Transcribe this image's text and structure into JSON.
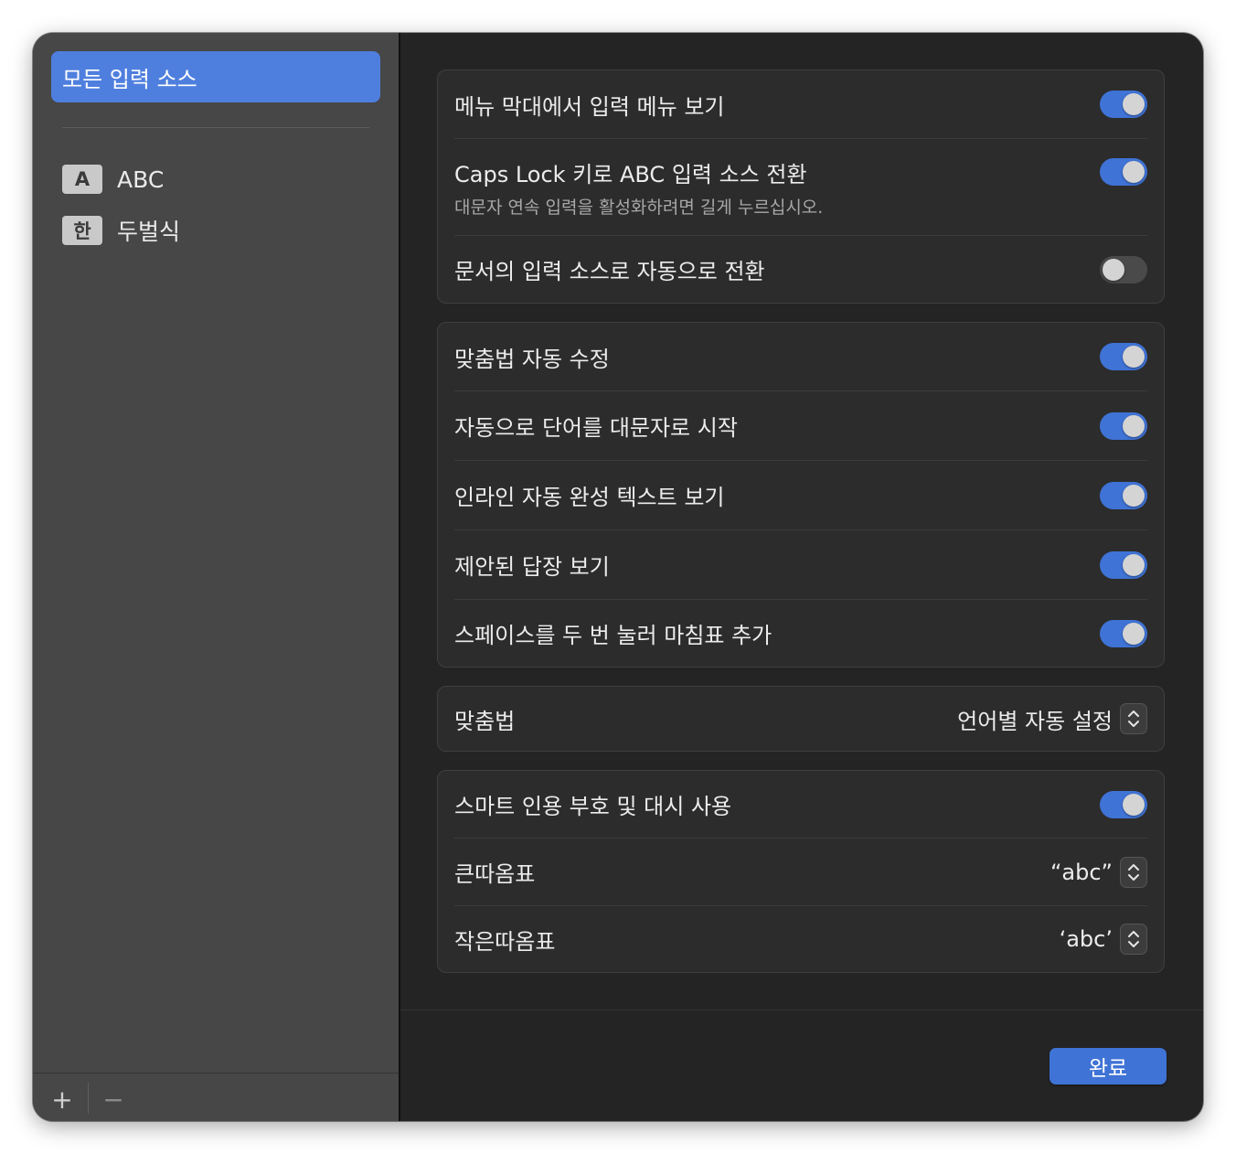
{
  "sidebar": {
    "selected_label": "모든 입력 소스",
    "sources": [
      {
        "badge": "A",
        "label": "ABC"
      },
      {
        "badge": "한",
        "label": "두벌식"
      }
    ],
    "add_label": "+",
    "remove_label": "−"
  },
  "group1": {
    "menu_bar": {
      "label": "메뉴 막대에서 입력 메뉴 보기",
      "on": true
    },
    "caps_lock": {
      "label": "Caps Lock 키로 ABC 입력 소스 전환",
      "sub": "대문자 연속 입력을 활성화하려면 길게 누르십시오.",
      "on": true
    },
    "auto_switch": {
      "label": "문서의 입력 소스로 자동으로 전환",
      "on": false
    }
  },
  "group2": {
    "spell_fix": {
      "label": "맞춤법 자동 수정",
      "on": true
    },
    "capitalize": {
      "label": "자동으로 단어를 대문자로 시작",
      "on": true
    },
    "inline_complete": {
      "label": "인라인 자동 완성 텍스트 보기",
      "on": true
    },
    "suggested_replies": {
      "label": "제안된 답장 보기",
      "on": true
    },
    "double_space": {
      "label": "스페이스를 두 번 눌러 마침표 추가",
      "on": true
    }
  },
  "group3": {
    "spelling": {
      "label": "맞춤법",
      "value": "언어별 자동 설정"
    }
  },
  "group4": {
    "smart_quotes": {
      "label": "스마트 인용 부호 및 대시 사용",
      "on": true
    },
    "double_quotes": {
      "label": "큰따옴표",
      "value": "“abc”"
    },
    "single_quotes": {
      "label": "작은따옴표",
      "value": "‘abc’"
    }
  },
  "footer": {
    "done_label": "완료"
  },
  "colors": {
    "accent": "#3f73d6",
    "sidebar_selection": "#4f7fde"
  }
}
